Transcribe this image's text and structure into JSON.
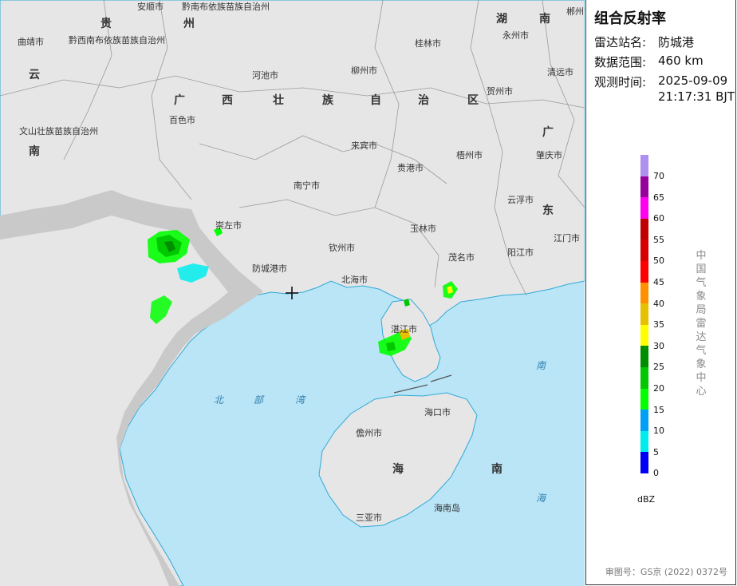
{
  "panel": {
    "title": "组合反射率",
    "station_label": "雷达站名:",
    "station_value": "防城港",
    "range_label": "数据范围:",
    "range_value": "460 km",
    "time_label": "观测时间:",
    "time_date": "2025-09-09",
    "time_clock": "21:17:31 BJT",
    "agency": "中国气象局雷达气象中心",
    "approval": "审图号：GS京 (2022) 0372号",
    "unit": "dBZ"
  },
  "legend": {
    "ticks": [
      "70",
      "65",
      "60",
      "55",
      "50",
      "45",
      "40",
      "35",
      "30",
      "25",
      "20",
      "15",
      "10",
      "5",
      "0"
    ],
    "colors": [
      "#ad90f0",
      "#96009b",
      "#ff00f0",
      "#c00000",
      "#d60000",
      "#ff0000",
      "#ff9000",
      "#e7c000",
      "#ffff00",
      "#008e00",
      "#01c800",
      "#02ff02",
      "#00a0f6",
      "#00ecec",
      "#0000f6"
    ]
  },
  "map": {
    "colors": {
      "land": "#e6e6e6",
      "sea": "#b9e5f6",
      "border": "#777777",
      "coast": "#31a8d8"
    },
    "cities": [
      "安顺市",
      "黔南布依族苗族自治州",
      "曲靖市",
      "黔西南布依族苗族自治州",
      "河池市",
      "柳州市",
      "桂林市",
      "永州市",
      "郴州市",
      "清远市",
      "贺州市",
      "百色市",
      "来宾市",
      "梧州市",
      "肇庆市",
      "文山壮族苗族自治州",
      "贵港市",
      "南宁市",
      "云浮市",
      "崇左市",
      "玉林市",
      "江门市",
      "钦州市",
      "防城港市",
      "北海市",
      "茂名市",
      "阳江市",
      "湛江市",
      "海口市",
      "儋州市",
      "海南岛",
      "三亚市"
    ],
    "province_chars": [
      "贵",
      "州",
      "湖",
      "南",
      "云",
      "南",
      "广",
      "西",
      "壮",
      "族",
      "自",
      "治",
      "区",
      "广",
      "东",
      "海",
      "南"
    ],
    "sea_labels": [
      "北",
      "部",
      "湾",
      "南",
      "海"
    ]
  }
}
